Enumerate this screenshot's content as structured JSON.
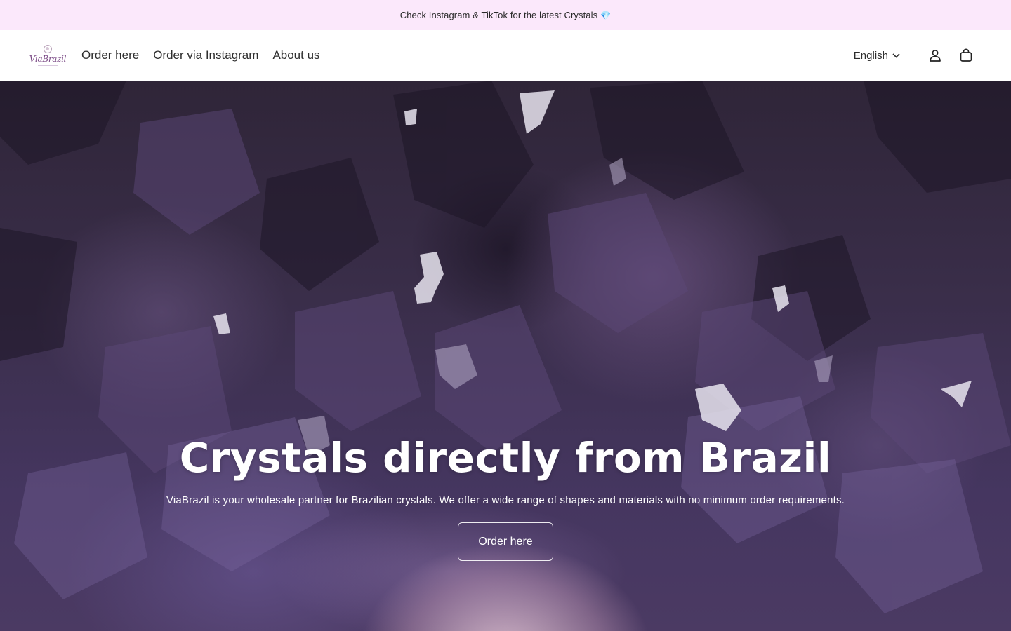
{
  "announcement": {
    "text": "Check Instagram & TikTok for the latest Crystals",
    "emoji": "💎"
  },
  "header": {
    "logo_text": "ViaBrazil",
    "nav": [
      {
        "label": "Order here"
      },
      {
        "label": "Order via Instagram"
      },
      {
        "label": "About us"
      }
    ],
    "language": "English",
    "icons": [
      "account-icon",
      "cart-icon",
      "chevron-down-icon"
    ]
  },
  "hero": {
    "title": "Crystals directly from Brazil",
    "subtitle": "ViaBrazil is your wholesale partner for Brazilian crystals. We offer a wide range of shapes and materials with no minimum order requirements.",
    "button_label": "Order here"
  },
  "colors": {
    "announcement_bg": "#fbe8fb",
    "hero_base": "#3a2e4a",
    "logo_purple": "#7b4a86"
  }
}
